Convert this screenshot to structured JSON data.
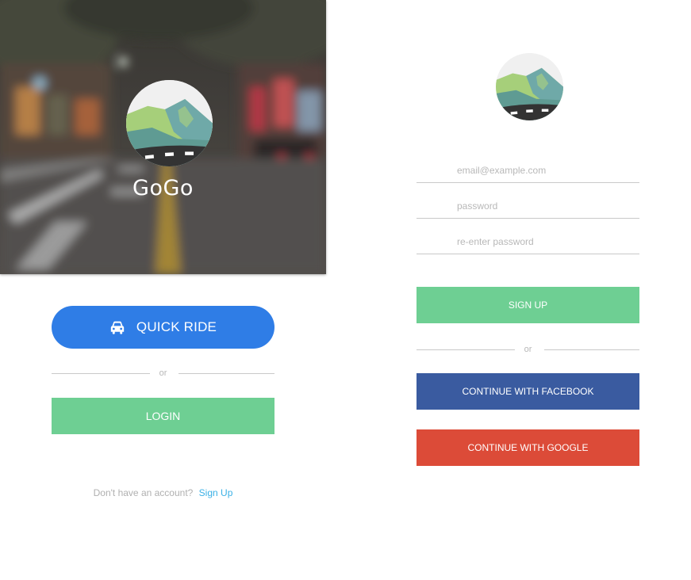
{
  "app": {
    "name": "GoGo"
  },
  "quick_ride": {
    "label": "QUICK RIDE",
    "icon": "car-icon"
  },
  "login_screen": {
    "divider_text": "or",
    "login_label": "LOGIN",
    "no_account_text": "Don't have an account?",
    "signup_link": "Sign Up"
  },
  "signup_screen": {
    "email_placeholder": "email@example.com",
    "password_placeholder": "password",
    "reenter_placeholder": "re-enter password",
    "signup_label": "SIGN UP",
    "divider_text": "or",
    "facebook_label": "CONTINUE WITH FACEBOOK",
    "google_label": "CONTINUE WITH GOOGLE"
  },
  "colors": {
    "quick_ride": "#2f7de6",
    "green": "#6ecf93",
    "facebook": "#3a5ba0",
    "google": "#dc4b38",
    "link": "#3ab0e6"
  }
}
